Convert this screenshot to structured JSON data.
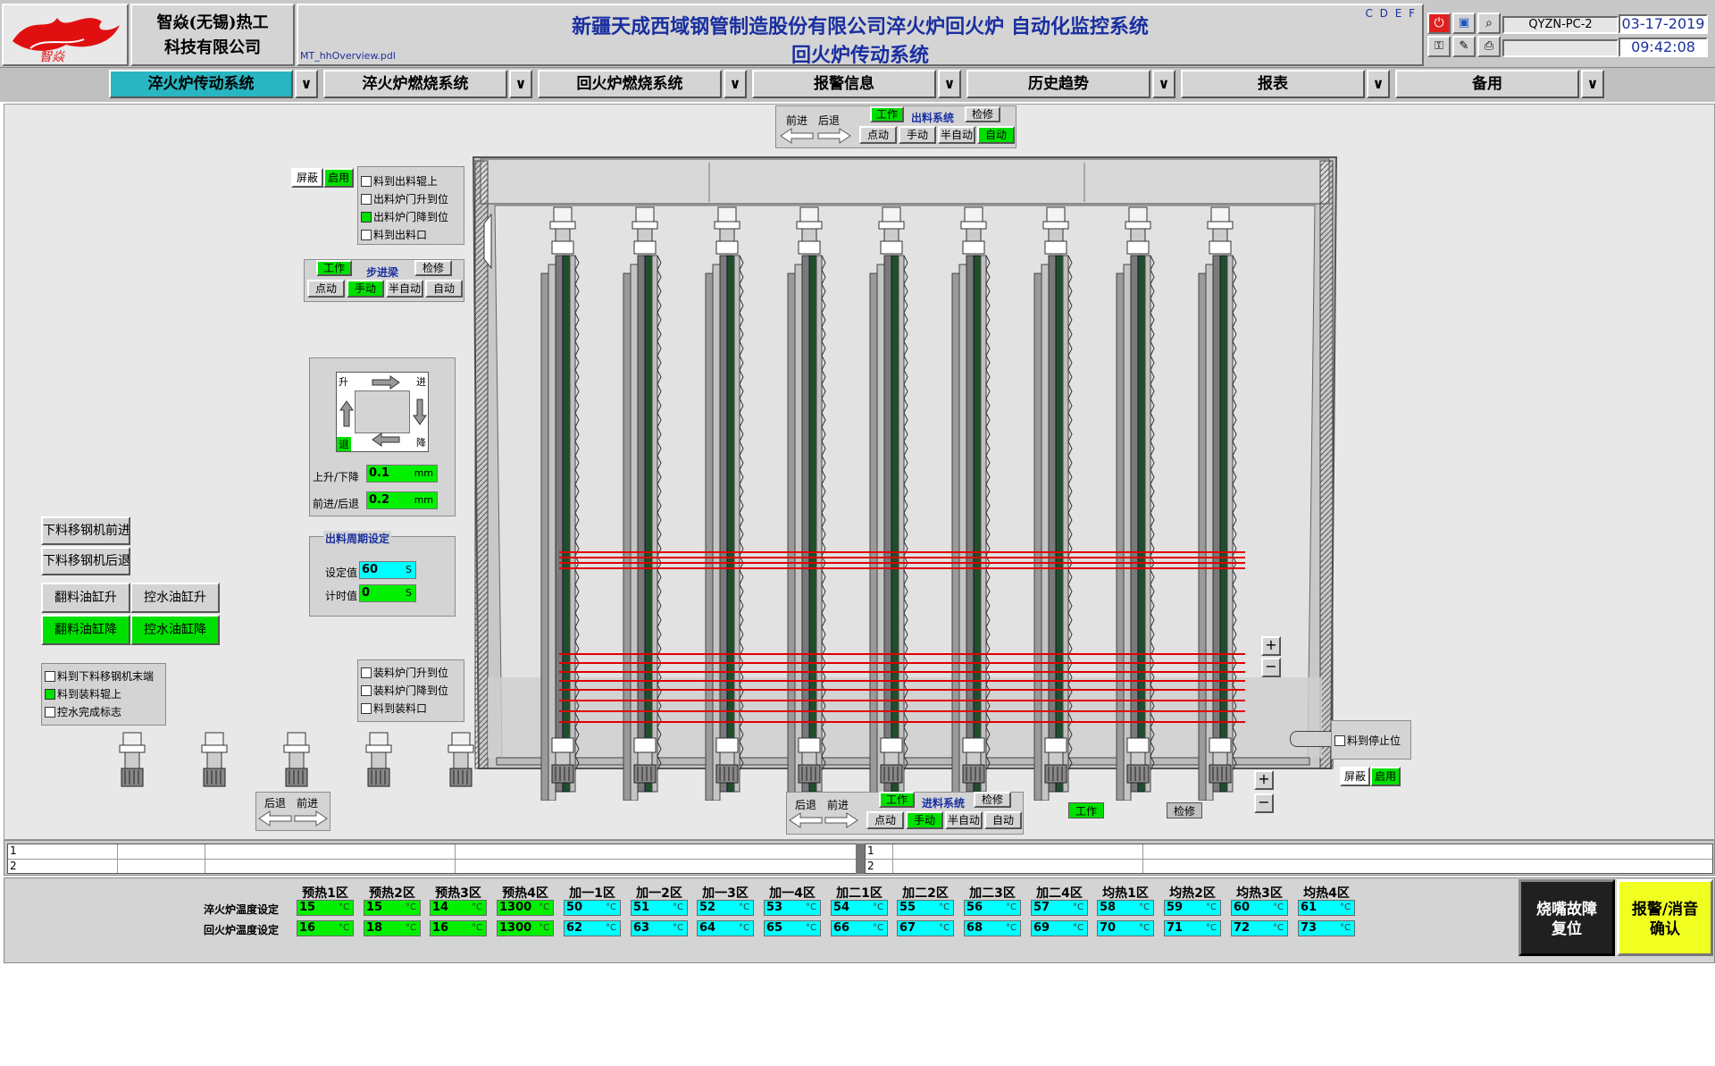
{
  "header": {
    "company_line1": "智焱(无锡)热工",
    "company_line2": "科技有限公司",
    "title_line1": "新疆天成西域钢管制造股份有限公司淬火炉回火炉 自动化监控系统",
    "title_line2": "回火炉传动系统",
    "file_name": "MT_hhOverview.pdl",
    "drive_letters": "C D E F",
    "pc_name": "QYZN-PC-2",
    "date": "03-17-2019",
    "time": "09:42:08"
  },
  "nav": {
    "tabs": [
      "淬火炉传动系统",
      "淬火炉燃烧系统",
      "回火炉燃烧系统",
      "报警信息",
      "历史趋势",
      "报表",
      "备用"
    ],
    "dropdown_glyph": "∨"
  },
  "top_mode": {
    "forward": "前进",
    "back": "后退",
    "work": "工作",
    "system": "出料系统",
    "maint": "检修",
    "jog": "点动",
    "manual": "手动",
    "semi": "半自动",
    "auto": "自动"
  },
  "left_shield": {
    "shield": "屏蔽",
    "enable": "启用"
  },
  "discharge_checks": [
    {
      "label": "料到出料辊上",
      "on": false
    },
    {
      "label": "出料炉门升到位",
      "on": false
    },
    {
      "label": "出料炉门降到位",
      "on": true
    },
    {
      "label": "料到出料口",
      "on": false
    }
  ],
  "step_mode": {
    "work": "工作",
    "system": "步进梁",
    "maint": "检修",
    "jog": "点动",
    "manual": "手动",
    "semi": "半自动",
    "auto": "自动"
  },
  "motion": {
    "up": "升",
    "in": "进",
    "back": "退",
    "down": "降",
    "lift_label": "上升/下降",
    "lift_value": "0.1",
    "lift_unit": "mm",
    "feed_label": "前进/后退",
    "feed_value": "0.2",
    "feed_unit": "mm"
  },
  "cycle": {
    "title": "出料周期设定",
    "set_label": "设定值",
    "set_value": "60",
    "timer_label": "计时值",
    "timer_value": "0",
    "unit": "S"
  },
  "left_buttons": {
    "unload_forward": "下料移钢机前进",
    "unload_back": "下料移钢机后退",
    "flip_up": "翻料油缸升",
    "drain_up": "控水油缸升",
    "flip_down": "翻料油缸降",
    "drain_down": "控水油缸降"
  },
  "load_checks": [
    {
      "label": "料到下料移钢机末端",
      "on": false
    },
    {
      "label": "料到装料辊上",
      "on": true
    },
    {
      "label": "控水完成标志",
      "on": false
    }
  ],
  "feed_checks": [
    {
      "label": "装料炉门升到位",
      "on": false
    },
    {
      "label": "装料炉门降到位",
      "on": false
    },
    {
      "label": "料到装料口",
      "on": false
    }
  ],
  "bottom_left_nav": {
    "back": "后退",
    "forward": "前进"
  },
  "bottom_mode": {
    "back": "后退",
    "forward": "前进",
    "work": "工作",
    "system": "进料系统",
    "maint": "检修",
    "jog": "点动",
    "manual": "手动",
    "semi": "半自动",
    "auto": "自动"
  },
  "status_indicators": {
    "work": "工作",
    "maint": "检修"
  },
  "right_panel": {
    "stop_check": "料到停止位",
    "shield": "屏蔽",
    "enable": "启用",
    "plus": "+",
    "minus": "−"
  },
  "alarm_rows": {
    "left": [
      "1",
      "2"
    ],
    "right": [
      "1",
      "2"
    ]
  },
  "temps": {
    "zones": [
      "预热1区",
      "预热2区",
      "预热3区",
      "预热4区",
      "加一1区",
      "加一2区",
      "加一3区",
      "加一4区",
      "加二1区",
      "加二2区",
      "加二3区",
      "加二4区",
      "均热1区",
      "均热2区",
      "均热3区",
      "均热4区"
    ],
    "row1_label": "淬火炉温度设定",
    "row2_label": "回火炉温度设定",
    "unit": "°C",
    "row1": [
      "15",
      "15",
      "14",
      "1300",
      "50",
      "51",
      "52",
      "53",
      "54",
      "55",
      "56",
      "57",
      "58",
      "59",
      "60",
      "61"
    ],
    "row2": [
      "16",
      "18",
      "16",
      "1300",
      "62",
      "63",
      "64",
      "65",
      "66",
      "67",
      "68",
      "69",
      "70",
      "71",
      "72",
      "73"
    ],
    "green_count": 4,
    "colors": {
      "green": "#00f000",
      "cyan": "#00ffff"
    }
  },
  "action_buttons": {
    "burner_reset_line1": "烧嘴故障",
    "burner_reset_line2": "复位",
    "alarm_ack_line1": "报警/消音",
    "alarm_ack_line2": "确认"
  },
  "colors": {
    "accent_tab": "#28b6c2",
    "active_green": "#00e000",
    "title_blue": "#1a2fa0",
    "rail_red": "#e00000"
  }
}
